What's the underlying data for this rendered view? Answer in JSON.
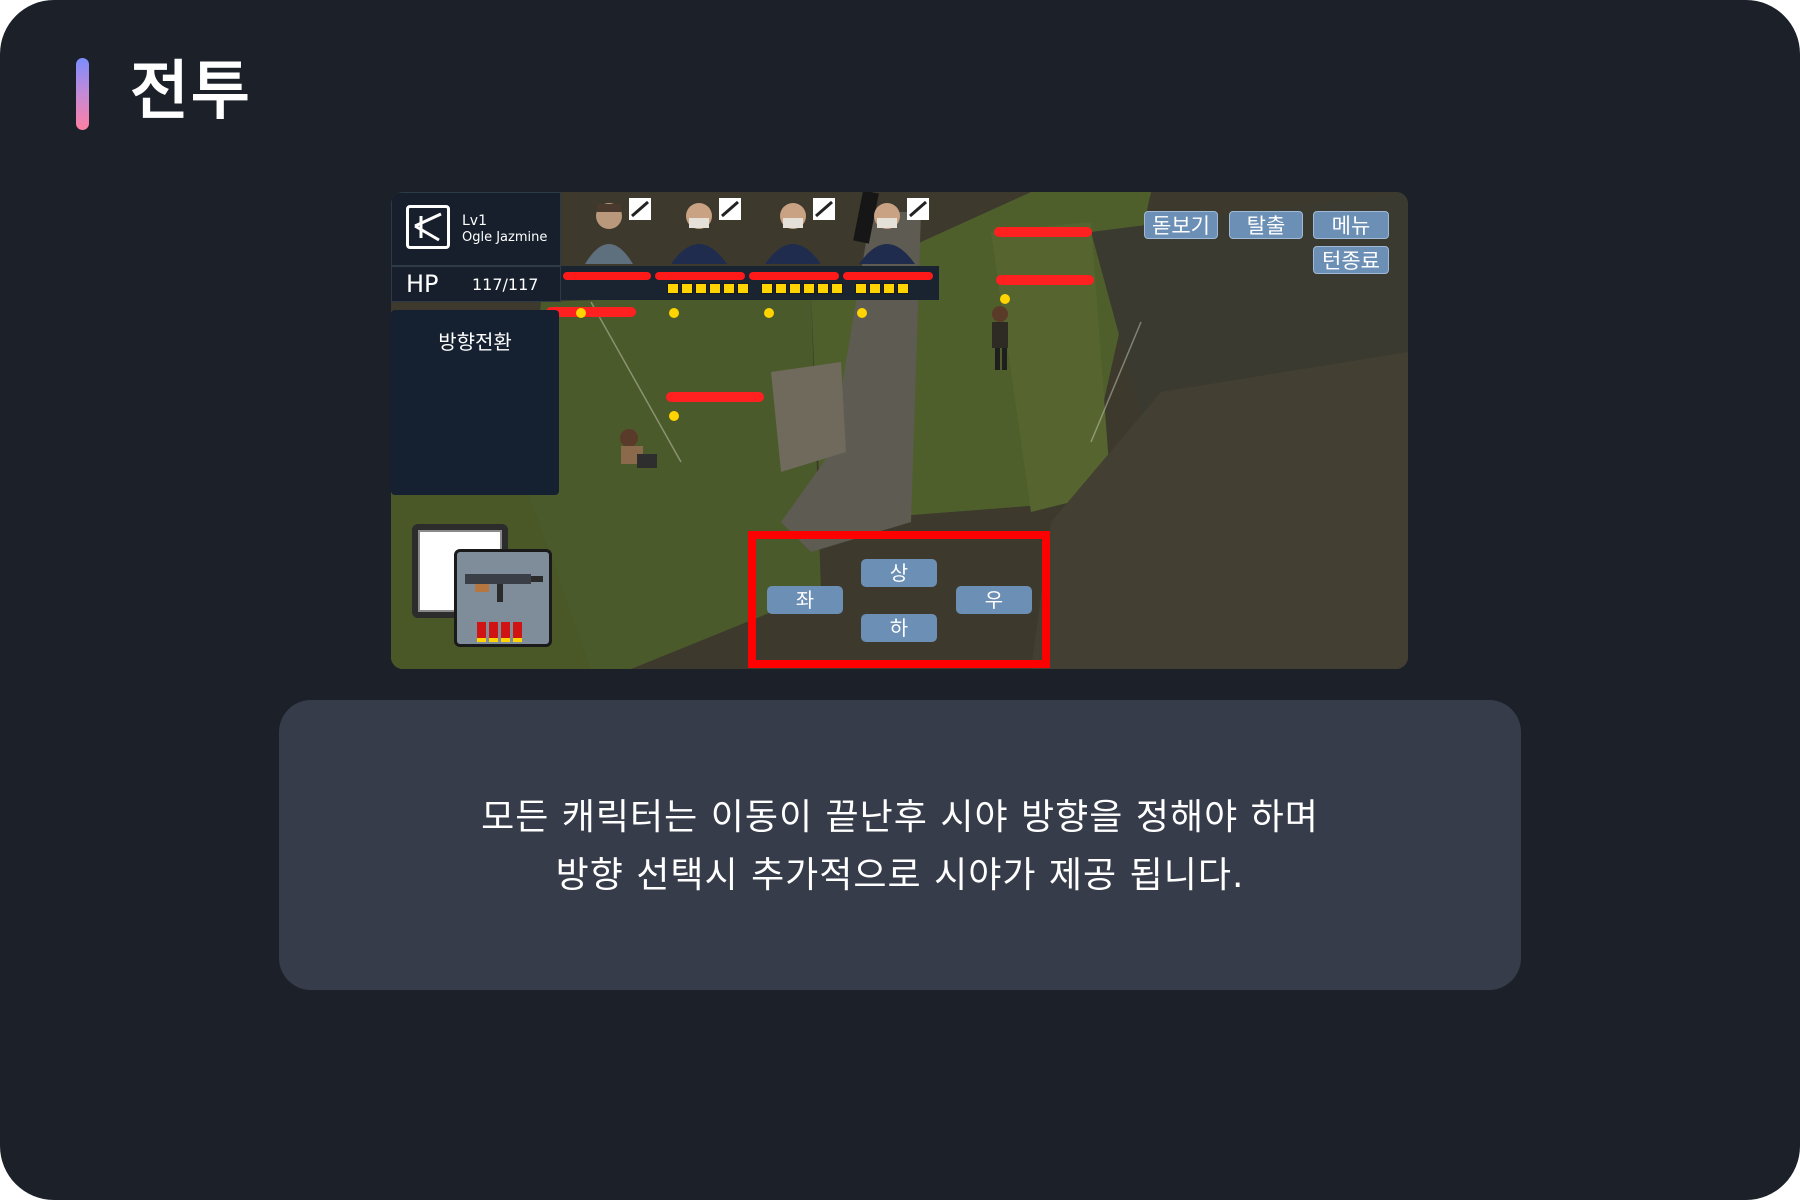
{
  "page": {
    "title": "전투",
    "caption_lines": [
      "모든 캐릭터는 이동이 끝난후 시야 방향을 정해야 하며",
      "방향 선택시 추가적으로 시야가 제공 됩니다."
    ]
  },
  "game": {
    "character": {
      "level": "Lv1",
      "name": "Ogle Jazmine",
      "hp_label": "HP",
      "hp_value": "117/117",
      "hp_fraction": 1.0
    },
    "side_panel_title": "방향전환",
    "top_buttons": {
      "zoom": "돋보기",
      "escape": "탈출",
      "menu": "메뉴",
      "end_turn": "턴종료"
    },
    "direction_buttons": {
      "up": "상",
      "down": "하",
      "left": "좌",
      "right": "우"
    },
    "team_ammo": [
      {
        "name": "portrait-1",
        "ammo": 0
      },
      {
        "name": "portrait-2",
        "ammo": 6
      },
      {
        "name": "portrait-3",
        "ammo": 6
      },
      {
        "name": "portrait-4",
        "ammo": 4
      }
    ],
    "weapon_ammo": 4,
    "colors": {
      "highlight": "#ff0000",
      "button": "#6c8fb5",
      "ammo": "#ffd400",
      "health": "#ff1a1a"
    },
    "icons": [
      "rifle-icon",
      "submachine-gun-icon"
    ]
  }
}
